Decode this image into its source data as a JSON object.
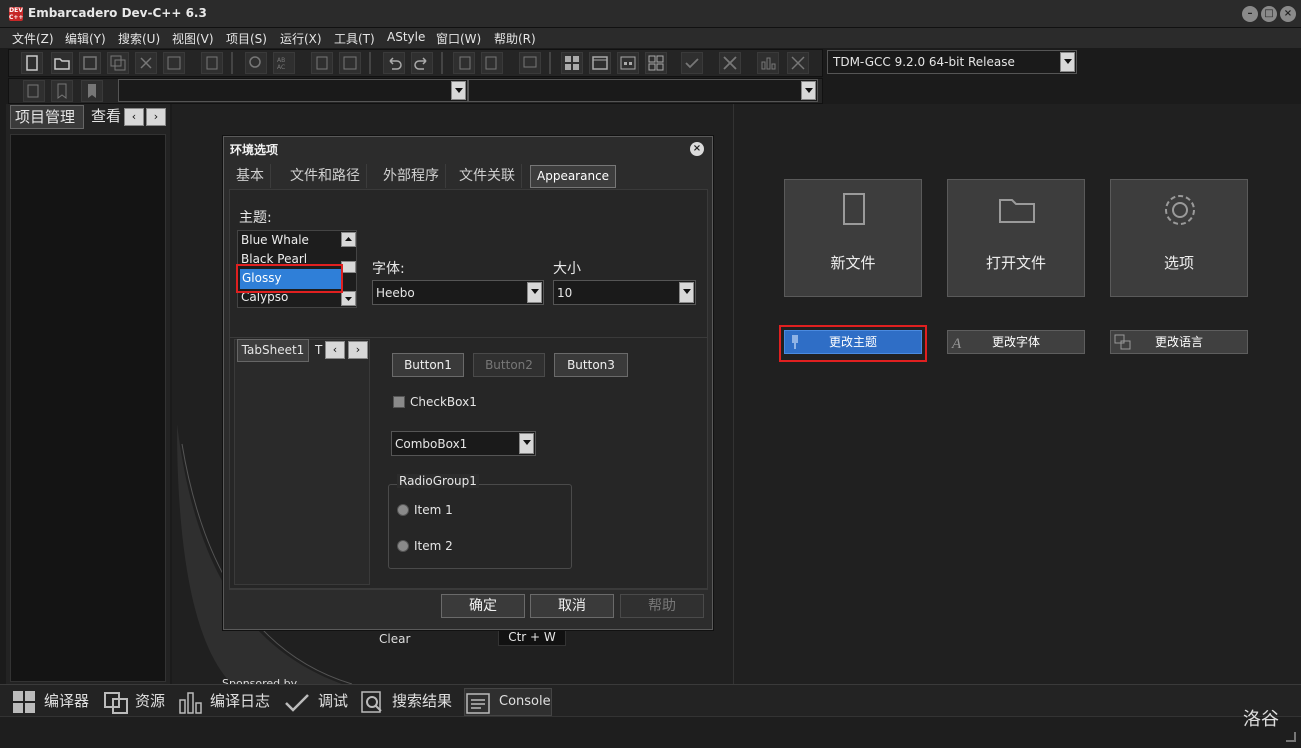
{
  "window": {
    "title": "Embarcadero Dev-C++ 6.3",
    "icon_text": "DEV C++"
  },
  "menu": [
    "文件(Z)",
    "编辑(Y)",
    "搜索(U)",
    "视图(V)",
    "项目(S)",
    "运行(X)",
    "工具(T)",
    "AStyle",
    "窗口(W)",
    "帮助(R)"
  ],
  "toolbar": {
    "compiler_select": "TDM-GCC 9.2.0 64-bit Release",
    "class_select": "",
    "member_select": ""
  },
  "left_panel": {
    "tabs": [
      "项目管理",
      "查看"
    ]
  },
  "dialog": {
    "title": "环境选项",
    "tabs": [
      "基本",
      "文件和路径",
      "外部程序",
      "文件关联",
      "Appearance"
    ],
    "active_tab": "Appearance",
    "theme_label": "主题:",
    "themes": [
      "Blue Whale",
      "Black Pearl",
      "Glossy",
      "Calypso"
    ],
    "selected_theme": "Glossy",
    "font_label": "字体:",
    "font_value": "Heebo",
    "size_label": "大小",
    "size_value": "10",
    "preview": {
      "tabs": [
        "TabSheet1",
        "T"
      ],
      "buttons": [
        "Button1",
        "Button2",
        "Button3"
      ],
      "checkbox": "CheckBox1",
      "combobox": "ComboBox1",
      "radio_group": "RadioGroup1",
      "radio_items": [
        "Item 1",
        "Item 2"
      ]
    },
    "ok": "确定",
    "cancel": "取消",
    "help": "帮助"
  },
  "welcome": {
    "tiles": [
      "新文件",
      "打开文件",
      "选项"
    ],
    "change_theme": "更改主题",
    "change_font": "更改字体",
    "change_language": "更改语言",
    "clear_label": "Clear",
    "shortcut": "Ctr + W",
    "sponsored": "Sponsored by"
  },
  "bottom_tabs": [
    "编译器",
    "资源",
    "编译日志",
    "调试",
    "搜索结果",
    "Console"
  ],
  "watermark": "洛谷"
}
